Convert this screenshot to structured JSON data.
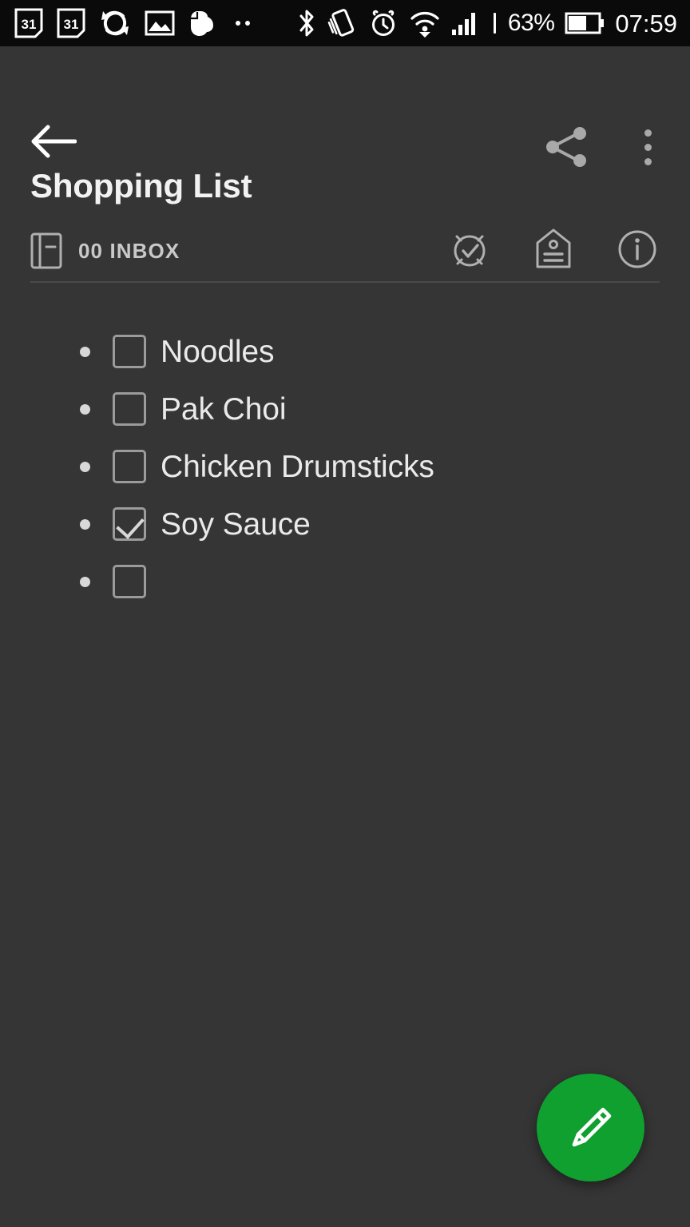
{
  "statusbar": {
    "background": "#0a0a0a",
    "left_icons": [
      {
        "name": "calendar-31-icon",
        "label": "31"
      },
      {
        "name": "calendar-31-icon-2",
        "label": "31"
      },
      {
        "name": "sync-rotate-icon",
        "label": ""
      },
      {
        "name": "image-icon",
        "label": ""
      },
      {
        "name": "evernote-elephant-icon",
        "label": ""
      },
      {
        "name": "more-notifications-dots-icon",
        "label": ""
      }
    ],
    "right_icons": [
      {
        "name": "bluetooth-icon",
        "label": ""
      },
      {
        "name": "vibrate-rotate-icon",
        "label": ""
      },
      {
        "name": "alarm-clock-icon",
        "label": ""
      },
      {
        "name": "wifi-icon",
        "label": ""
      },
      {
        "name": "cellular-signal-icon",
        "label": ""
      }
    ],
    "battery_percent": "63%",
    "time": "07:59"
  },
  "appbar": {
    "back_label": "Back",
    "share_label": "Share",
    "overflow_label": "More options"
  },
  "note": {
    "title": "Shopping List",
    "notebook": "00 INBOX",
    "meta_actions": [
      {
        "name": "reminder-icon",
        "label": "Reminder"
      },
      {
        "name": "tag-icon",
        "label": "Tags"
      },
      {
        "name": "info-icon",
        "label": "Note info"
      }
    ]
  },
  "checklist": {
    "items": [
      {
        "text": "Noodles",
        "checked": false
      },
      {
        "text": "Pak Choi",
        "checked": false
      },
      {
        "text": "Chicken Drumsticks",
        "checked": false
      },
      {
        "text": "Soy Sauce",
        "checked": true
      },
      {
        "text": "",
        "checked": false
      }
    ]
  },
  "fab": {
    "label": "Edit note",
    "color": "#10a02f",
    "icon": "pencil-icon"
  },
  "colors": {
    "background": "#353535",
    "statusbar": "#0a0a0a",
    "text_primary": "#eaeaea",
    "text_secondary": "#c9c9c9",
    "accent_green": "#10a02f",
    "divider": "#4a4a4a"
  }
}
